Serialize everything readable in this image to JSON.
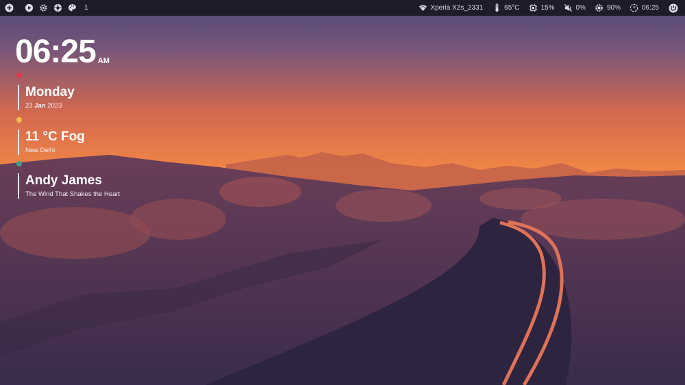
{
  "colors": {
    "topbar_bg": "#1c1d29",
    "topbar_text": "#d9dbe6",
    "dot_date": "#e0364f",
    "dot_weather": "#f1c247",
    "dot_music": "#3aa38c",
    "sky_top": "#4d4a78",
    "sky_horizon": "#f5874a",
    "road": "#2e2440",
    "road_line": "#e07258"
  },
  "topbar": {
    "left": {
      "icons": [
        "add-icon",
        "play-icon",
        "gear-icon",
        "aperture-icon",
        "palette-icon"
      ],
      "workspace": "1"
    },
    "right": {
      "wifi": {
        "icon": "wifi-icon",
        "label": "Xperia X2s_2331"
      },
      "temperature": {
        "icon": "thermometer-icon",
        "label": "65°C"
      },
      "cpu": {
        "icon": "cpu-icon",
        "label": "15%"
      },
      "volume": {
        "icon": "mute-icon",
        "label": "0%"
      },
      "brightness": {
        "icon": "brightness-icon",
        "label": "90%"
      },
      "time": {
        "icon": "clock-icon",
        "label": "06:25"
      },
      "power": {
        "icon": "power-icon"
      }
    }
  },
  "widgets": {
    "clock": {
      "time": "06:25",
      "ampm": "AM"
    },
    "date": {
      "day": "Monday",
      "date_day": "23",
      "date_month": "Jan",
      "date_year": "2023"
    },
    "weather": {
      "summary": "11 °C Fog",
      "location": "New Delhi"
    },
    "music": {
      "artist": "Andy James",
      "track": "The Wind That Shakes the Heart"
    }
  }
}
